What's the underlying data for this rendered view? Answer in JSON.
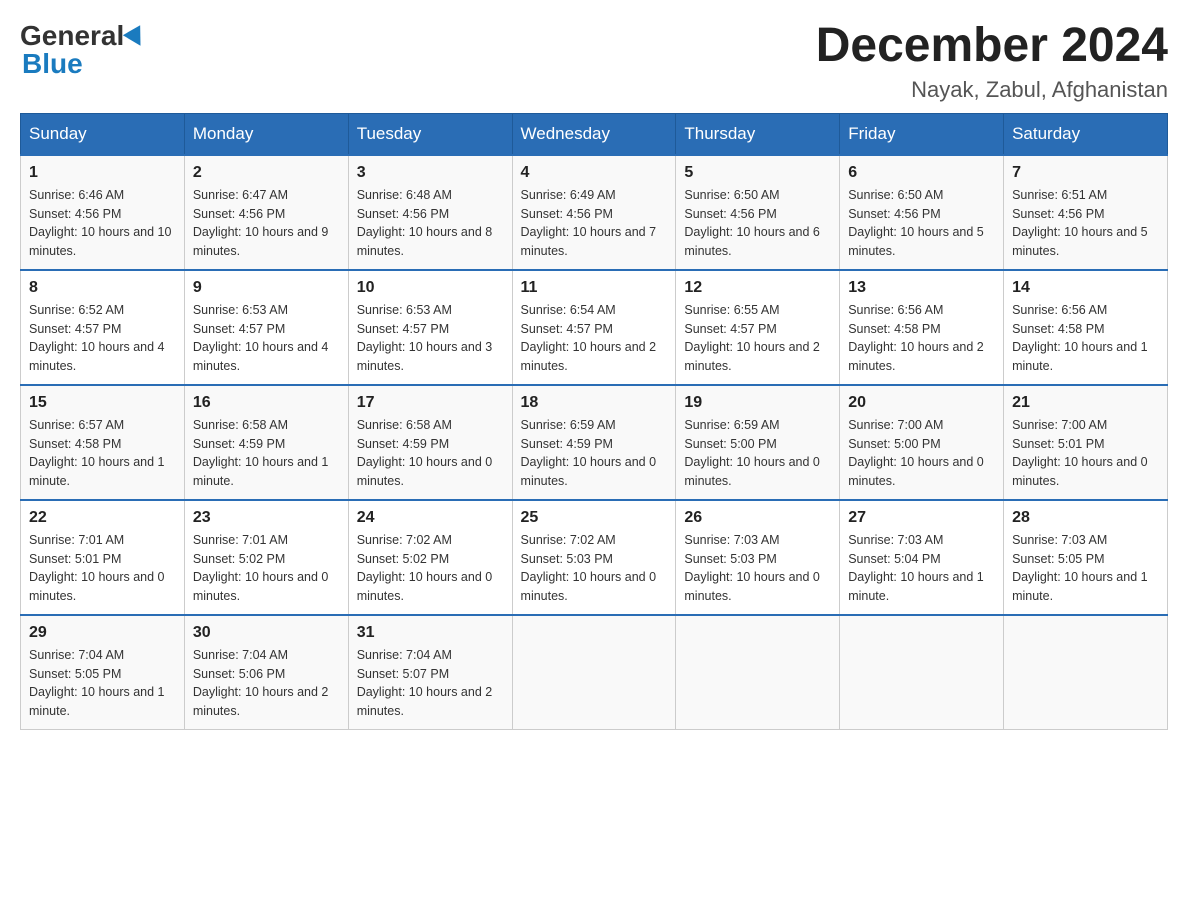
{
  "header": {
    "logo_general": "General",
    "logo_blue": "Blue",
    "month_title": "December 2024",
    "location": "Nayak, Zabul, Afghanistan"
  },
  "days_of_week": [
    "Sunday",
    "Monday",
    "Tuesday",
    "Wednesday",
    "Thursday",
    "Friday",
    "Saturday"
  ],
  "weeks": [
    [
      {
        "day": "1",
        "sunrise": "6:46 AM",
        "sunset": "4:56 PM",
        "daylight": "10 hours and 10 minutes."
      },
      {
        "day": "2",
        "sunrise": "6:47 AM",
        "sunset": "4:56 PM",
        "daylight": "10 hours and 9 minutes."
      },
      {
        "day": "3",
        "sunrise": "6:48 AM",
        "sunset": "4:56 PM",
        "daylight": "10 hours and 8 minutes."
      },
      {
        "day": "4",
        "sunrise": "6:49 AM",
        "sunset": "4:56 PM",
        "daylight": "10 hours and 7 minutes."
      },
      {
        "day": "5",
        "sunrise": "6:50 AM",
        "sunset": "4:56 PM",
        "daylight": "10 hours and 6 minutes."
      },
      {
        "day": "6",
        "sunrise": "6:50 AM",
        "sunset": "4:56 PM",
        "daylight": "10 hours and 5 minutes."
      },
      {
        "day": "7",
        "sunrise": "6:51 AM",
        "sunset": "4:56 PM",
        "daylight": "10 hours and 5 minutes."
      }
    ],
    [
      {
        "day": "8",
        "sunrise": "6:52 AM",
        "sunset": "4:57 PM",
        "daylight": "10 hours and 4 minutes."
      },
      {
        "day": "9",
        "sunrise": "6:53 AM",
        "sunset": "4:57 PM",
        "daylight": "10 hours and 4 minutes."
      },
      {
        "day": "10",
        "sunrise": "6:53 AM",
        "sunset": "4:57 PM",
        "daylight": "10 hours and 3 minutes."
      },
      {
        "day": "11",
        "sunrise": "6:54 AM",
        "sunset": "4:57 PM",
        "daylight": "10 hours and 2 minutes."
      },
      {
        "day": "12",
        "sunrise": "6:55 AM",
        "sunset": "4:57 PM",
        "daylight": "10 hours and 2 minutes."
      },
      {
        "day": "13",
        "sunrise": "6:56 AM",
        "sunset": "4:58 PM",
        "daylight": "10 hours and 2 minutes."
      },
      {
        "day": "14",
        "sunrise": "6:56 AM",
        "sunset": "4:58 PM",
        "daylight": "10 hours and 1 minute."
      }
    ],
    [
      {
        "day": "15",
        "sunrise": "6:57 AM",
        "sunset": "4:58 PM",
        "daylight": "10 hours and 1 minute."
      },
      {
        "day": "16",
        "sunrise": "6:58 AM",
        "sunset": "4:59 PM",
        "daylight": "10 hours and 1 minute."
      },
      {
        "day": "17",
        "sunrise": "6:58 AM",
        "sunset": "4:59 PM",
        "daylight": "10 hours and 0 minutes."
      },
      {
        "day": "18",
        "sunrise": "6:59 AM",
        "sunset": "4:59 PM",
        "daylight": "10 hours and 0 minutes."
      },
      {
        "day": "19",
        "sunrise": "6:59 AM",
        "sunset": "5:00 PM",
        "daylight": "10 hours and 0 minutes."
      },
      {
        "day": "20",
        "sunrise": "7:00 AM",
        "sunset": "5:00 PM",
        "daylight": "10 hours and 0 minutes."
      },
      {
        "day": "21",
        "sunrise": "7:00 AM",
        "sunset": "5:01 PM",
        "daylight": "10 hours and 0 minutes."
      }
    ],
    [
      {
        "day": "22",
        "sunrise": "7:01 AM",
        "sunset": "5:01 PM",
        "daylight": "10 hours and 0 minutes."
      },
      {
        "day": "23",
        "sunrise": "7:01 AM",
        "sunset": "5:02 PM",
        "daylight": "10 hours and 0 minutes."
      },
      {
        "day": "24",
        "sunrise": "7:02 AM",
        "sunset": "5:02 PM",
        "daylight": "10 hours and 0 minutes."
      },
      {
        "day": "25",
        "sunrise": "7:02 AM",
        "sunset": "5:03 PM",
        "daylight": "10 hours and 0 minutes."
      },
      {
        "day": "26",
        "sunrise": "7:03 AM",
        "sunset": "5:03 PM",
        "daylight": "10 hours and 0 minutes."
      },
      {
        "day": "27",
        "sunrise": "7:03 AM",
        "sunset": "5:04 PM",
        "daylight": "10 hours and 1 minute."
      },
      {
        "day": "28",
        "sunrise": "7:03 AM",
        "sunset": "5:05 PM",
        "daylight": "10 hours and 1 minute."
      }
    ],
    [
      {
        "day": "29",
        "sunrise": "7:04 AM",
        "sunset": "5:05 PM",
        "daylight": "10 hours and 1 minute."
      },
      {
        "day": "30",
        "sunrise": "7:04 AM",
        "sunset": "5:06 PM",
        "daylight": "10 hours and 2 minutes."
      },
      {
        "day": "31",
        "sunrise": "7:04 AM",
        "sunset": "5:07 PM",
        "daylight": "10 hours and 2 minutes."
      },
      null,
      null,
      null,
      null
    ]
  ]
}
